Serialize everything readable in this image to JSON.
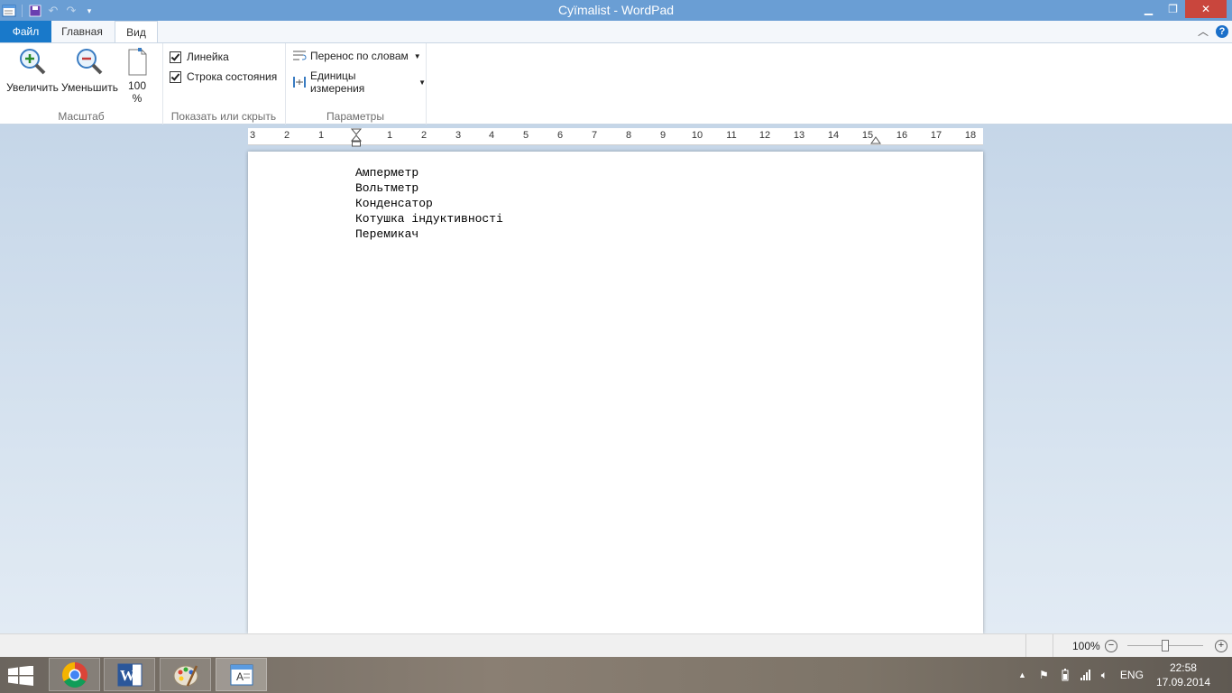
{
  "window": {
    "title": "Cyïmalist - WordPad",
    "min_glyph": "▁",
    "max_glyph": "❐",
    "close_glyph": "✕"
  },
  "tabs": {
    "file": "Файл",
    "home": "Главная",
    "view": "Вид"
  },
  "ribbon": {
    "zoom_group": {
      "label": "Масштаб",
      "zoom_in": "Увеличить",
      "zoom_out": "Уменьшить",
      "zoom_100_line1": "100",
      "zoom_100_line2": "%"
    },
    "show_group": {
      "label": "Показать или скрыть",
      "ruler": "Линейка",
      "ruler_checked": true,
      "statusbar": "Строка состояния",
      "statusbar_checked": true
    },
    "options_group": {
      "label": "Параметры",
      "word_wrap": "Перенос по словам",
      "units": "Единицы измерения"
    }
  },
  "ruler": {
    "marks": [
      "3",
      "2",
      "1",
      "1",
      "2",
      "3",
      "4",
      "5",
      "6",
      "7",
      "8",
      "9",
      "10",
      "11",
      "12",
      "13",
      "14",
      "15",
      "16",
      "17",
      "18"
    ]
  },
  "document": {
    "lines": [
      "Амперметр",
      "Вольтметр",
      "Конденсатор",
      "Котушка індуктивності",
      "Перемикач"
    ]
  },
  "statusbar": {
    "zoom": "100%",
    "zoom_level_percent": 100
  },
  "taskbar": {
    "lang": "ENG",
    "time": "22:58",
    "date": "17.09.2014",
    "apps": [
      "chrome-icon",
      "word-icon",
      "paint-icon",
      "wordpad-icon"
    ]
  }
}
